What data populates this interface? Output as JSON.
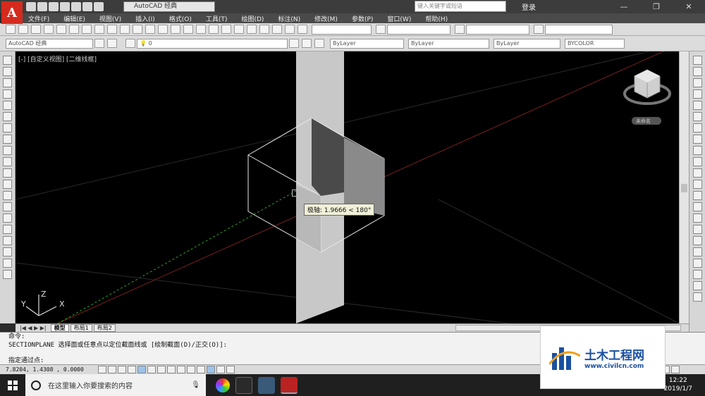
{
  "titlebar": {
    "workspace": "AutoCAD 经典",
    "search_placeholder": "键入关键字或短语",
    "login": "登录",
    "app_logo": "A"
  },
  "menu": [
    "文件(F)",
    "编辑(E)",
    "视图(V)",
    "插入(I)",
    "格式(O)",
    "工具(T)",
    "绘图(D)",
    "标注(N)",
    "修改(M)",
    "参数(P)",
    "窗口(W)",
    "帮助(H)"
  ],
  "toolbar2": {
    "workspace": "AutoCAD 经典",
    "layer": "0",
    "color": "ByLayer",
    "linetype": "ByLayer",
    "lineweight": "ByLayer",
    "plotstyle": "BYCOLOR"
  },
  "viewport": {
    "label": "[-] [自定义视图] [二维线框]",
    "tooltip": "极轴: 1.9666 < 180°",
    "viewcube_label": "未命名",
    "ucs_x": "X",
    "ucs_y": "Y",
    "ucs_z": "Z"
  },
  "tabs": [
    "模型",
    "布局1",
    "布局2"
  ],
  "command": {
    "line1": "命令:",
    "line2": "SECTIONPLANE 选择面或任意点以定位截面线或 [绘制截面(D)/正交(O)]:",
    "line3": "指定通过点:"
  },
  "status": {
    "coords": "7.8204, 1.4308 , 0.0000"
  },
  "taskbar": {
    "search_placeholder": "在这里输入你要搜索的内容",
    "time": "12:22",
    "date": "2019/1/7"
  },
  "watermark": {
    "name": "土木工程网",
    "url": "www.civilcn.com"
  }
}
